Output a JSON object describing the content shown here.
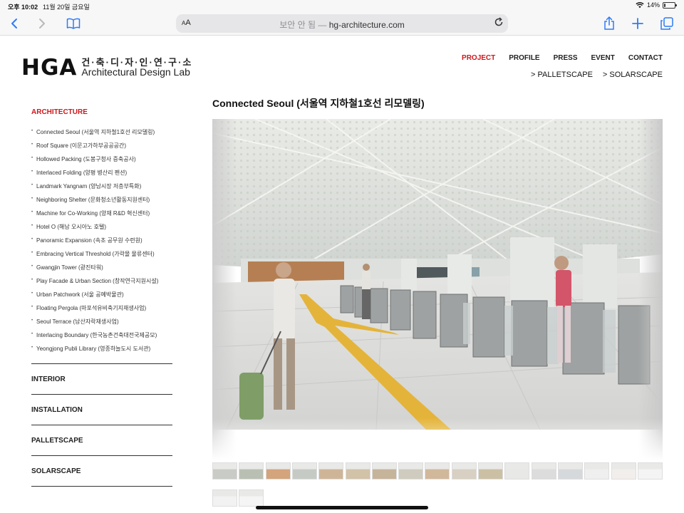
{
  "status_bar": {
    "time": "오후 10:02",
    "date": "11월 20일 금요일",
    "battery": "14%",
    "battery_level": 0.14
  },
  "browser": {
    "aa": "AA",
    "insecure_label": "보안 안 됨",
    "separator": " — ",
    "domain": "hg-architecture.com"
  },
  "logo": {
    "mark": "HGA",
    "korean": "건·축·디·자·인·연·구·소",
    "english": "Architectural Design Lab"
  },
  "nav": {
    "items": [
      "PROJECT",
      "PROFILE",
      "PRESS",
      "EVENT",
      "CONTACT"
    ],
    "sub_items": [
      "> PALLETSCAPE",
      "> SOLARSCAPE"
    ],
    "active_color": "#d0161b"
  },
  "sidebar": {
    "heading": "ARCHITECTURE",
    "projects": [
      "Connected Seoul (서울역 지하철1호선 리모델링)",
      "Roof Square (이문고가하부공공공간)",
      "Hollowed Packing (도봉구청사 증축공사)",
      "Interlaced Folding (양평 병산리 펜션)",
      "Landmark Yangnam (양남시장 저층부특화)",
      "Neighboring Shelter (문화청소년활동지원센터)",
      "Machine for Co-Working (양재 R&D 혁신센터)",
      "Hotel O (해남 오시아노 호텔)",
      "Panoramic Expansion (속초 공무원 수련원)",
      "Embracing Vertical Threshold (가락몰 물류센터)",
      "Gwangjin Tower (광진타워)",
      "Play Facade & Urban Section (창작연극지원시설)",
      "Urban Patchwork (서울 공예박물관)",
      "Floating Pergola (마포석유비축기지재생사업)",
      "Seoul Terrace (남산자락재생사업)",
      "Interlacing Boundary (한국농촌건축대전국제공모)",
      "Yeongjong Publi Library (영종하늘도시 도서관)"
    ],
    "sections": [
      "INTERIOR",
      "INSTALLATION",
      "PALLETSCAPE",
      "SOLARSCAPE"
    ]
  },
  "main": {
    "title": "Connected Seoul (서울역 지하철1호선 리모델링)",
    "thumbnail_count": 19
  }
}
